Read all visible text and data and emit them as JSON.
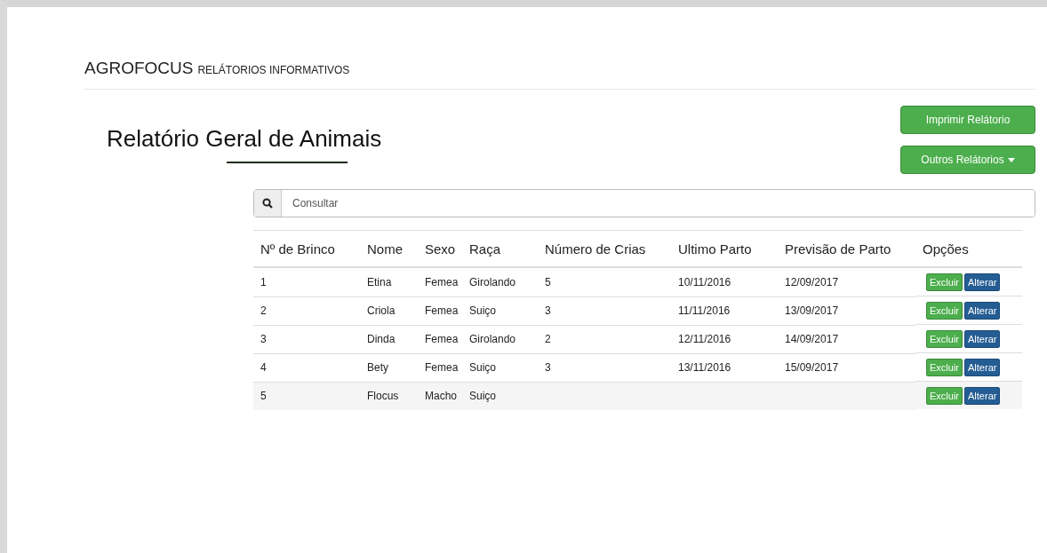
{
  "header": {
    "brand": "AGROFOCUS",
    "subtitle": "RELÁTORIOS INFORMATIVOS"
  },
  "page_title": "Relatório Geral de Animais",
  "buttons": [
    {
      "label": "Imprimir Relátorio",
      "dropdown": false
    },
    {
      "label": "Outros Relátorios",
      "dropdown": true
    }
  ],
  "search": {
    "placeholder": "Consultar"
  },
  "table": {
    "columns": [
      "Nº de Brinco",
      "Nome",
      "Sexo",
      "Raça",
      "Número de Crias",
      "Ultimo Parto",
      "Previsão de Parto",
      "Opções"
    ],
    "rows": [
      {
        "cells": [
          "1",
          "Etina",
          "Femea",
          "Girolando",
          "5",
          "10/11/2016",
          "12/09/2017"
        ],
        "actions": [
          "Excluir",
          "Alterar"
        ],
        "selected": false
      },
      {
        "cells": [
          "2",
          "Criola",
          "Femea",
          "Suiço",
          "3",
          "11/11/2016",
          "13/09/2017"
        ],
        "actions": [
          "Excluir",
          "Alterar"
        ],
        "selected": false
      },
      {
        "cells": [
          "3",
          "Dinda",
          "Femea",
          "Girolando",
          "2",
          "12/11/2016",
          "14/09/2017"
        ],
        "actions": [
          "Excluir",
          "Alterar"
        ],
        "selected": false
      },
      {
        "cells": [
          "4",
          "Bety",
          "Femea",
          "Suiço",
          "3",
          "13/11/2016",
          "15/09/2017"
        ],
        "actions": [
          "Excluir",
          "Alterar"
        ],
        "selected": false
      },
      {
        "cells": [
          "5",
          "Flocus",
          "Macho",
          "Suiço",
          "",
          "",
          ""
        ],
        "actions": [
          "Excluir",
          "Alterar"
        ],
        "selected": true
      }
    ]
  }
}
